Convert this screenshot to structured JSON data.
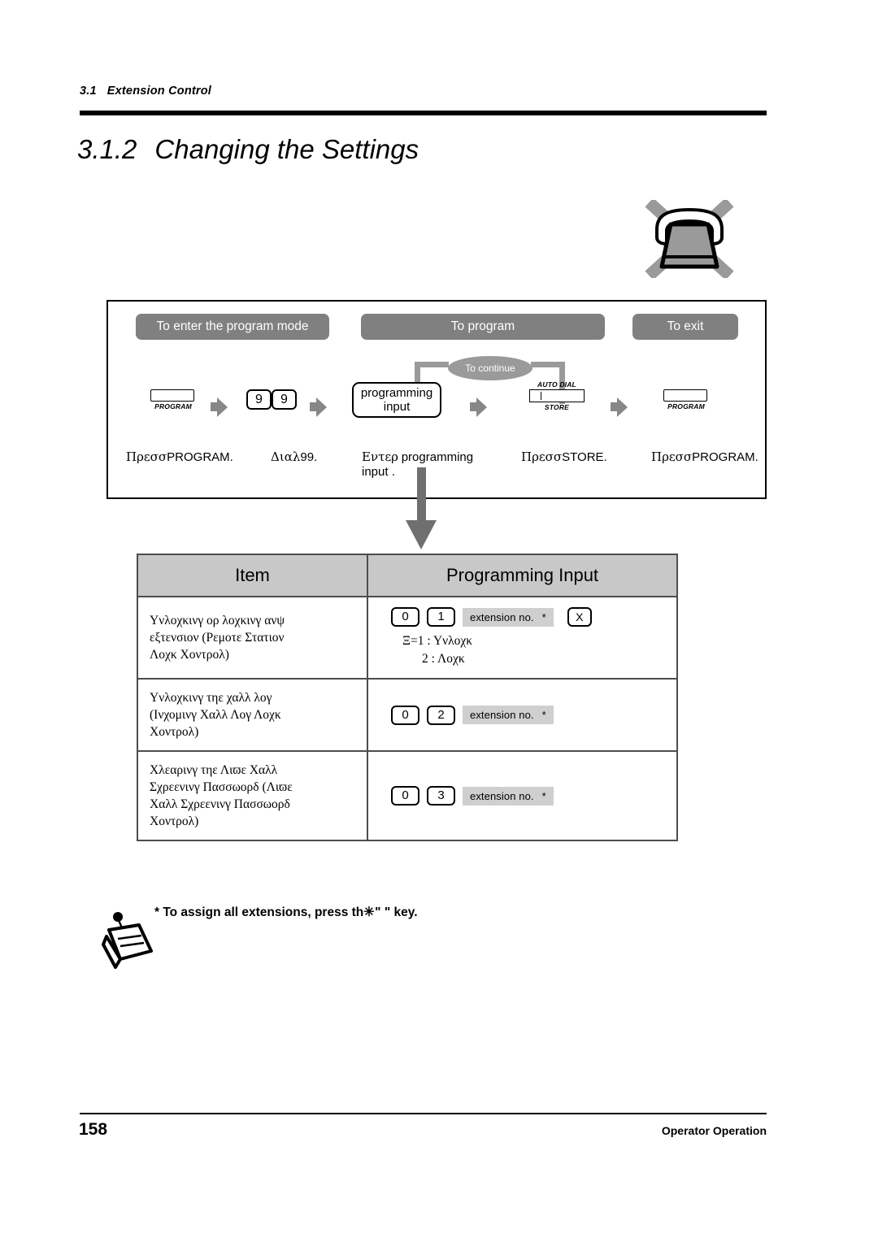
{
  "running_head": {
    "section_number": "3.1",
    "section_title": "Extension Control"
  },
  "title": {
    "number": "3.1.2",
    "text": "Changing the Settings"
  },
  "flow": {
    "phases": [
      {
        "id": "enter",
        "label": "To enter the program mode"
      },
      {
        "id": "program",
        "label": "To program"
      },
      {
        "id": "exit",
        "label": "To exit"
      }
    ],
    "continue_label": "To continue",
    "steps": [
      {
        "key_type": "program-key",
        "key_label": "PROGRAM",
        "caption_symbol": "Πρεσσ",
        "caption_latin": "PROGRAM."
      },
      {
        "key_type": "digit-keys",
        "digits": [
          "9",
          "9"
        ],
        "caption_symbol": "Διαλ",
        "caption_latin": "99."
      },
      {
        "key_type": "input-box",
        "box_line1": "programming",
        "box_line2": "input",
        "caption_symbol": "Εντερ",
        "caption_latin": "programming",
        "caption_latin2": "input ."
      },
      {
        "key_type": "store-key",
        "key_top_label": "AUTO DIAL",
        "key_bottom_label": "STORE",
        "caption_symbol": "Πρεσσ",
        "caption_latin": "STORE."
      },
      {
        "key_type": "program-key",
        "key_label": "PROGRAM",
        "caption_symbol": "Πρεσσ",
        "caption_latin": "PROGRAM."
      }
    ]
  },
  "table": {
    "headers": [
      "Item",
      "Programming Input"
    ],
    "rows": [
      {
        "item_lines": [
          "Υνλοχκινγ ορ λοχκινγ ανψ",
          "εξτενσιον (Ρεμοτε Στατιον",
          "Λοχκ Χοντρολ)"
        ],
        "keys": [
          "0",
          "1"
        ],
        "chip_label": "extension no.",
        "chip_star": "*",
        "x_key": "X",
        "options": [
          "Ξ=1 : Υνλοχκ",
          "2 : Λοχκ"
        ]
      },
      {
        "item_lines": [
          "Υνλοχκινγ τηε χαλλ λογ",
          "(Ινχομινγ Χαλλ Λογ Λοχκ",
          "Χοντρολ)"
        ],
        "keys": [
          "0",
          "2"
        ],
        "chip_label": "extension no.",
        "chip_star": "*",
        "x_key": null,
        "options": []
      },
      {
        "item_lines": [
          "Χλεαρινγ τηε Λιϖε Χαλλ",
          "Σχρεενινγ Πασσωορδ (Λιϖε",
          "Χαλλ Σχρεενινγ Πασσωορδ",
          "Χοντρολ)"
        ],
        "keys": [
          "0",
          "3"
        ],
        "chip_label": "extension no.",
        "chip_star": "*",
        "x_key": null,
        "options": []
      }
    ]
  },
  "footnote": {
    "prefix": "* To assign all extensions, press th",
    "star_symbol": "✳",
    "suffix": "\"   \" key."
  },
  "footer": {
    "page_number": "158",
    "label": "Operator Operation"
  },
  "colors": {
    "phase_bar": "#808080",
    "continue_bubble": "#9a9a9a",
    "table_header": "#c8c8c8",
    "chip": "#cfcfcf",
    "arrow": "#878787",
    "big_arrow": "#6f6f6f"
  }
}
